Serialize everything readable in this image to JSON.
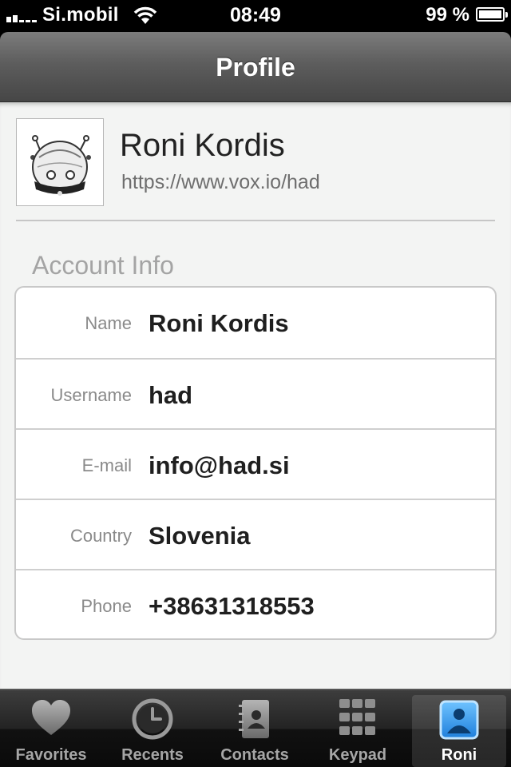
{
  "status_bar": {
    "carrier": "Si.mobil",
    "time": "08:49",
    "battery_percent": "99 %",
    "battery_level": 0.99
  },
  "nav": {
    "title": "Profile"
  },
  "profile": {
    "name": "Roni Kordis",
    "url": "https://www.vox.io/had",
    "avatar": "robot-avatar"
  },
  "account": {
    "header": "Account Info",
    "rows": [
      {
        "label": "Name",
        "value": "Roni Kordis"
      },
      {
        "label": "Username",
        "value": "had"
      },
      {
        "label": "E-mail",
        "value": "info@had.si"
      },
      {
        "label": "Country",
        "value": "Slovenia"
      },
      {
        "label": "Phone",
        "value": "+38631318553"
      }
    ]
  },
  "tabs": [
    {
      "label": "Favorites",
      "icon": "heart-icon"
    },
    {
      "label": "Recents",
      "icon": "clock-icon"
    },
    {
      "label": "Contacts",
      "icon": "address-book-icon"
    },
    {
      "label": "Keypad",
      "icon": "keypad-icon"
    },
    {
      "label": "Roni",
      "icon": "person-icon",
      "selected": true
    }
  ],
  "colors": {
    "background": "#f3f4f3",
    "nav_bar": "#5d5d5d",
    "tab_bar": "#1a1a1a",
    "selected_tab_icon": "#2a8fe6"
  }
}
